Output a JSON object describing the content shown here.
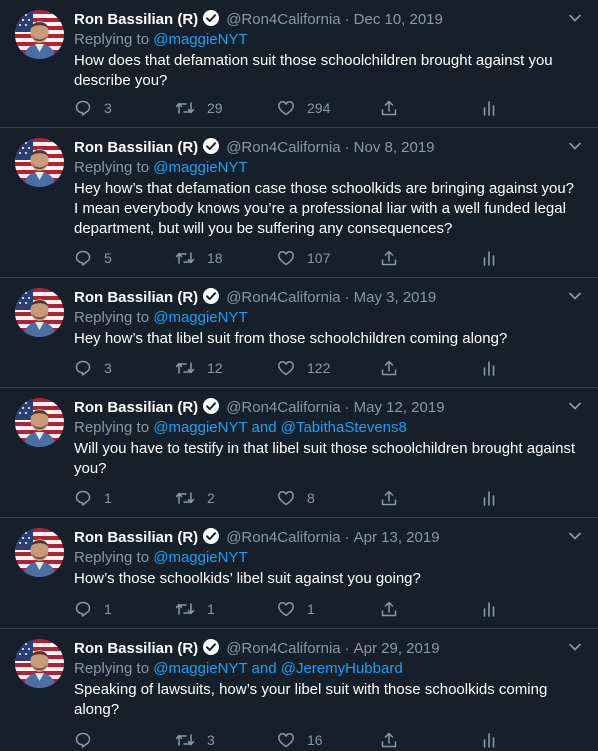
{
  "author": {
    "name": "Ron Bassilian (R)",
    "handle": "@Ron4California"
  },
  "tweets": [
    {
      "date": "Dec 10, 2019",
      "replying_label": "Replying to",
      "replying_to": "@maggieNYT",
      "text": "How does that defamation suit those schoolchildren brought against you describe you?",
      "replies": "3",
      "retweets": "29",
      "likes": "294"
    },
    {
      "date": "Nov 8, 2019",
      "replying_label": "Replying to",
      "replying_to": "@maggieNYT",
      "text": "Hey how’s that defamation case those schoolkids are bringing against you? I mean everybody knows you’re a professional liar with a well funded legal department, but will you be suffering any consequences?",
      "replies": "5",
      "retweets": "18",
      "likes": "107"
    },
    {
      "date": "May 3, 2019",
      "replying_label": "Replying to",
      "replying_to": "@maggieNYT",
      "text": "Hey how’s that libel suit from those schoolchildren coming along?",
      "replies": "3",
      "retweets": "12",
      "likes": "122"
    },
    {
      "date": "May 12, 2019",
      "replying_label": "Replying to",
      "replying_to": "@maggieNYT and @TabithaStevens8",
      "text": "Will you have to testify in that libel suit those schoolchildren brought against you?",
      "replies": "1",
      "retweets": "2",
      "likes": "8"
    },
    {
      "date": "Apr 13, 2019",
      "replying_label": "Replying to",
      "replying_to": "@maggieNYT",
      "text": "How’s those schoolkids’ libel suit against you going?",
      "replies": "1",
      "retweets": "1",
      "likes": "1"
    },
    {
      "date": "Apr 29, 2019",
      "replying_label": "Replying to",
      "replying_to": "@maggieNYT and @JeremyHubbard",
      "text": "Speaking of lawsuits, how’s your libel suit with those schoolkids coming along?",
      "replies": "",
      "retweets": "3",
      "likes": "16"
    }
  ],
  "icons": {
    "reply": "reply-icon",
    "retweet": "retweet-icon",
    "like": "heart-icon",
    "share": "share-icon",
    "analytics": "analytics-icon",
    "verified": "verified-badge-icon",
    "menu": "chevron-down-icon"
  },
  "colors": {
    "background": "#15202b",
    "muted": "#8899a6",
    "link": "#1da1f2",
    "divider": "#38444d"
  }
}
